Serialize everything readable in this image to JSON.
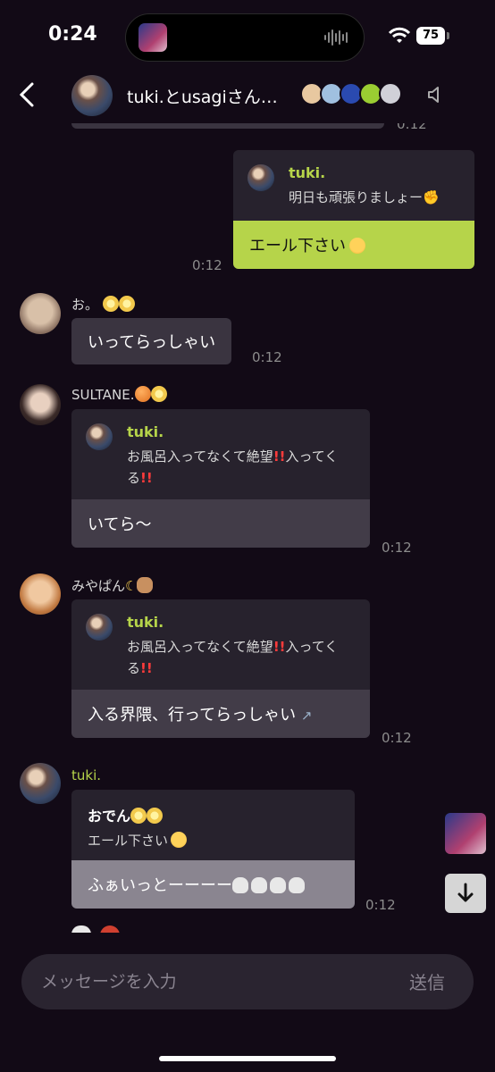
{
  "status_bar": {
    "time": "0:24",
    "battery": "75"
  },
  "header": {
    "title": "tuki.とusagiさん…"
  },
  "messages": {
    "m1": {
      "time": "0:12",
      "quote_name": "tuki.",
      "quote_text": "明日も頑張りましょー",
      "body": "エール下さい"
    },
    "m2": {
      "sender": "お。",
      "body": "いってらっしゃい",
      "time": "0:12"
    },
    "m3": {
      "sender": "SULTANE.",
      "quote_name": "tuki.",
      "quote_text_1": "お風呂入ってなくて絶望",
      "quote_text_2": "入ってくる",
      "body": "いてら〜",
      "time": "0:12"
    },
    "m4": {
      "sender": "みやぱん",
      "quote_name": "tuki.",
      "quote_text_1": "お風呂入ってなくて絶望",
      "quote_text_2": "入ってくる",
      "body": "入る界隈、行ってらっしゃい",
      "time": "0:12"
    },
    "m5": {
      "sender": "tuki.",
      "quote_name": "おでん",
      "quote_text": "エール下さい",
      "body": "ふぁいっとーーーー",
      "time": "0:12"
    }
  },
  "top_partial_time": "0:12",
  "input": {
    "placeholder": "メッセージを入力",
    "send_label": "送信"
  },
  "colors": {
    "background": "#120a16",
    "accent": "#b6d44a",
    "bubble": "#3a3440"
  },
  "icons": [
    "back-chevron-icon",
    "speaker-icon",
    "scroll-down-arrow-icon",
    "wifi-icon",
    "battery-icon"
  ]
}
